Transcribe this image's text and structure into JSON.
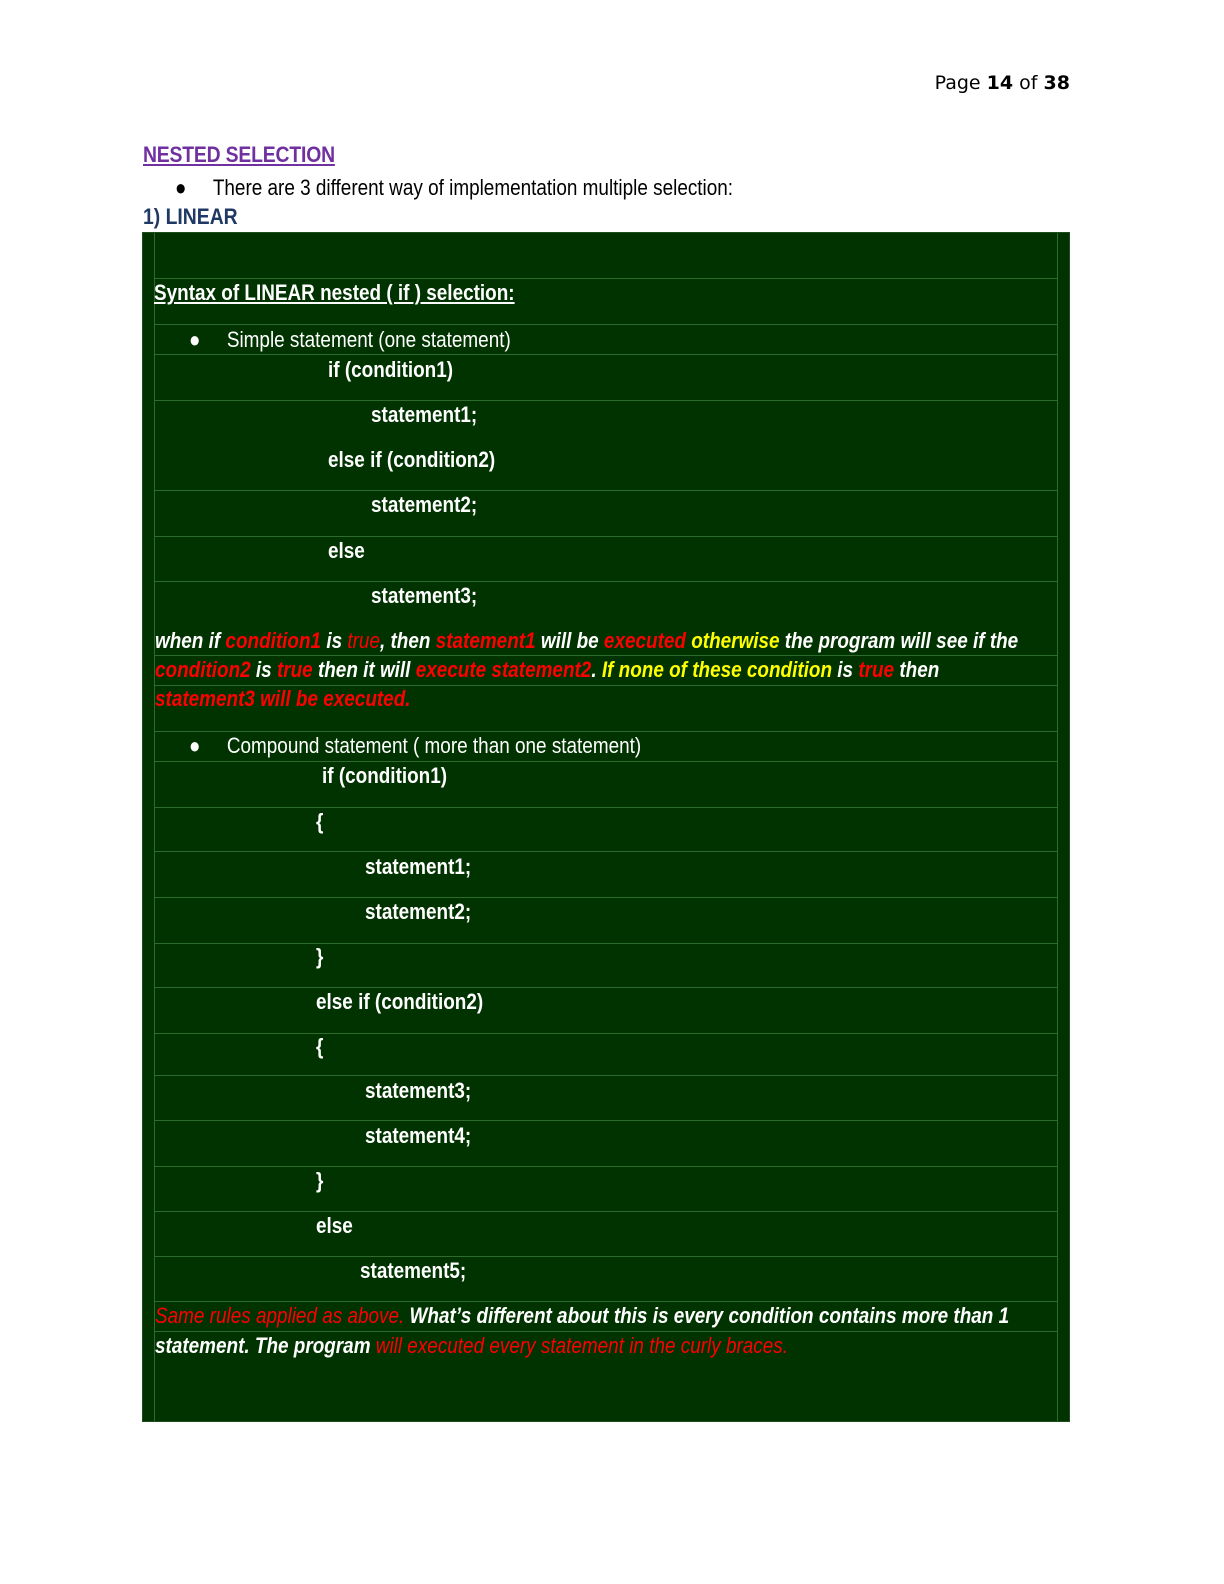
{
  "page": {
    "label": "Page",
    "current": "14",
    "of": "of",
    "total": "38"
  },
  "heading": "NESTED SELECTION",
  "intro": "There are 3 different way of implementation multiple selection:",
  "section": "1) LINEAR",
  "box": {
    "syntax_title": "Syntax of LINEAR nested ( if ) selection:",
    "simple": {
      "bullet": "Simple statement (one statement)",
      "lines": [
        "if (condition1)",
        "statement1;",
        "else if (condition2)",
        "statement2;",
        "else",
        "statement3;"
      ]
    },
    "explain1": {
      "l1": [
        "when if ",
        "condition1",
        " is ",
        "true",
        ", then ",
        "statement1",
        " will be ",
        "executed",
        " otherwise",
        " the program will see if the"
      ],
      "l2": [
        "condition2",
        " is ",
        "true",
        " then it will ",
        "execute statement2",
        ". ",
        "If none of these condition",
        " is ",
        "true",
        " then"
      ],
      "l3": [
        "statement3 will be executed."
      ]
    },
    "compound": {
      "bullet": "Compound statement ( more than one statement)",
      "lines": [
        "if (condition1)",
        "{",
        "statement1;",
        "statement2;",
        "}",
        "else if (condition2)",
        "{",
        "statement3;",
        "statement4;",
        "}",
        "else",
        "statement5;"
      ]
    },
    "explain2": {
      "l1": [
        "Same rules applied as above.",
        " What’s different about this is every condition contains more than 1"
      ],
      "l2": [
        "statement. The program ",
        "will executed every statement in the curly braces."
      ]
    }
  },
  "colors": {
    "heading": "#7030a0",
    "section": "#1f3864",
    "box_bg": "#003300",
    "red": "#ff0000",
    "yellow": "#ffff00"
  }
}
